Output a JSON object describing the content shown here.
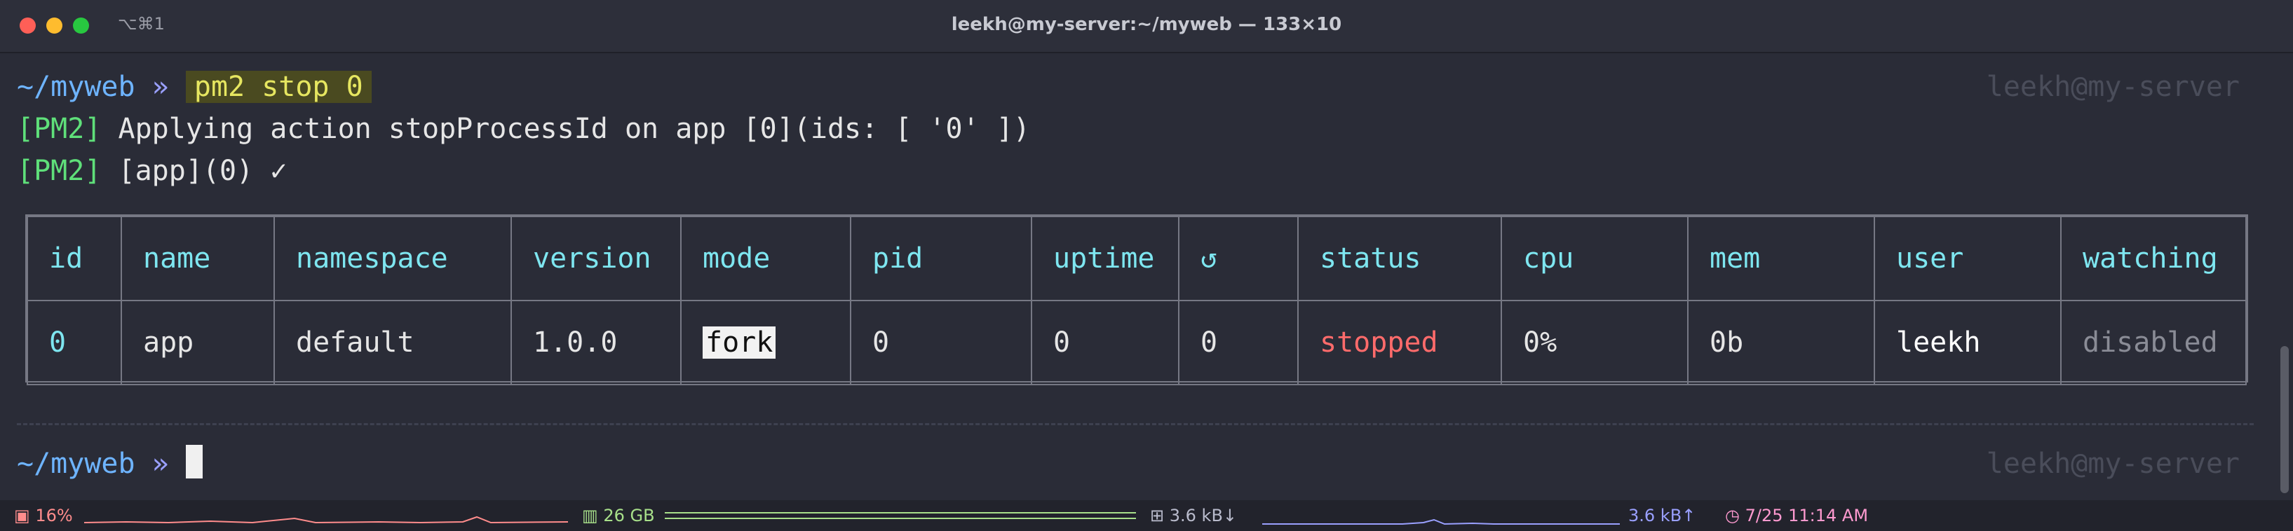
{
  "window": {
    "shortcut": "⌥⌘1",
    "title": "leekh@my-server:~/myweb — 133×10"
  },
  "terminal": {
    "prompt_path": "~/myweb",
    "prompt_arrow": "»",
    "command": "pm2 stop 0",
    "right_prompt": "leekh@my-server",
    "output": [
      {
        "tag": "[PM2]",
        "text": " Applying action stopProcessId on app [0](ids: [ '0' ])"
      },
      {
        "tag": "[PM2]",
        "text": " [app](0) ✓"
      }
    ],
    "table": {
      "headers": [
        "id",
        "name",
        "namespace",
        "version",
        "mode",
        "pid",
        "uptime",
        "↺",
        "status",
        "cpu",
        "mem",
        "user",
        "watching"
      ],
      "row": {
        "id": "0",
        "name": "app",
        "namespace": "default",
        "version": "1.0.0",
        "mode": "fork",
        "pid": "0",
        "uptime": "0",
        "restarts": "0",
        "status": "stopped",
        "cpu": "0%",
        "mem": "0b",
        "user": "leekh",
        "watching": "disabled"
      }
    },
    "second_prompt_path": "~/myweb",
    "second_prompt_arrow": "»"
  },
  "statusbar": {
    "cpu": "16%",
    "memory": "26 GB",
    "net_down": "3.6 kB↓",
    "net_up": "3.6 kB↑",
    "datetime": "7/25 11:14 AM"
  },
  "colors": {
    "background": "#2a2c37",
    "path": "#6eb4ff",
    "pm2_tag": "#5fe07a",
    "header": "#7ee6f0",
    "stopped": "#ff6b6b",
    "command_highlight": "#4a4a20"
  }
}
